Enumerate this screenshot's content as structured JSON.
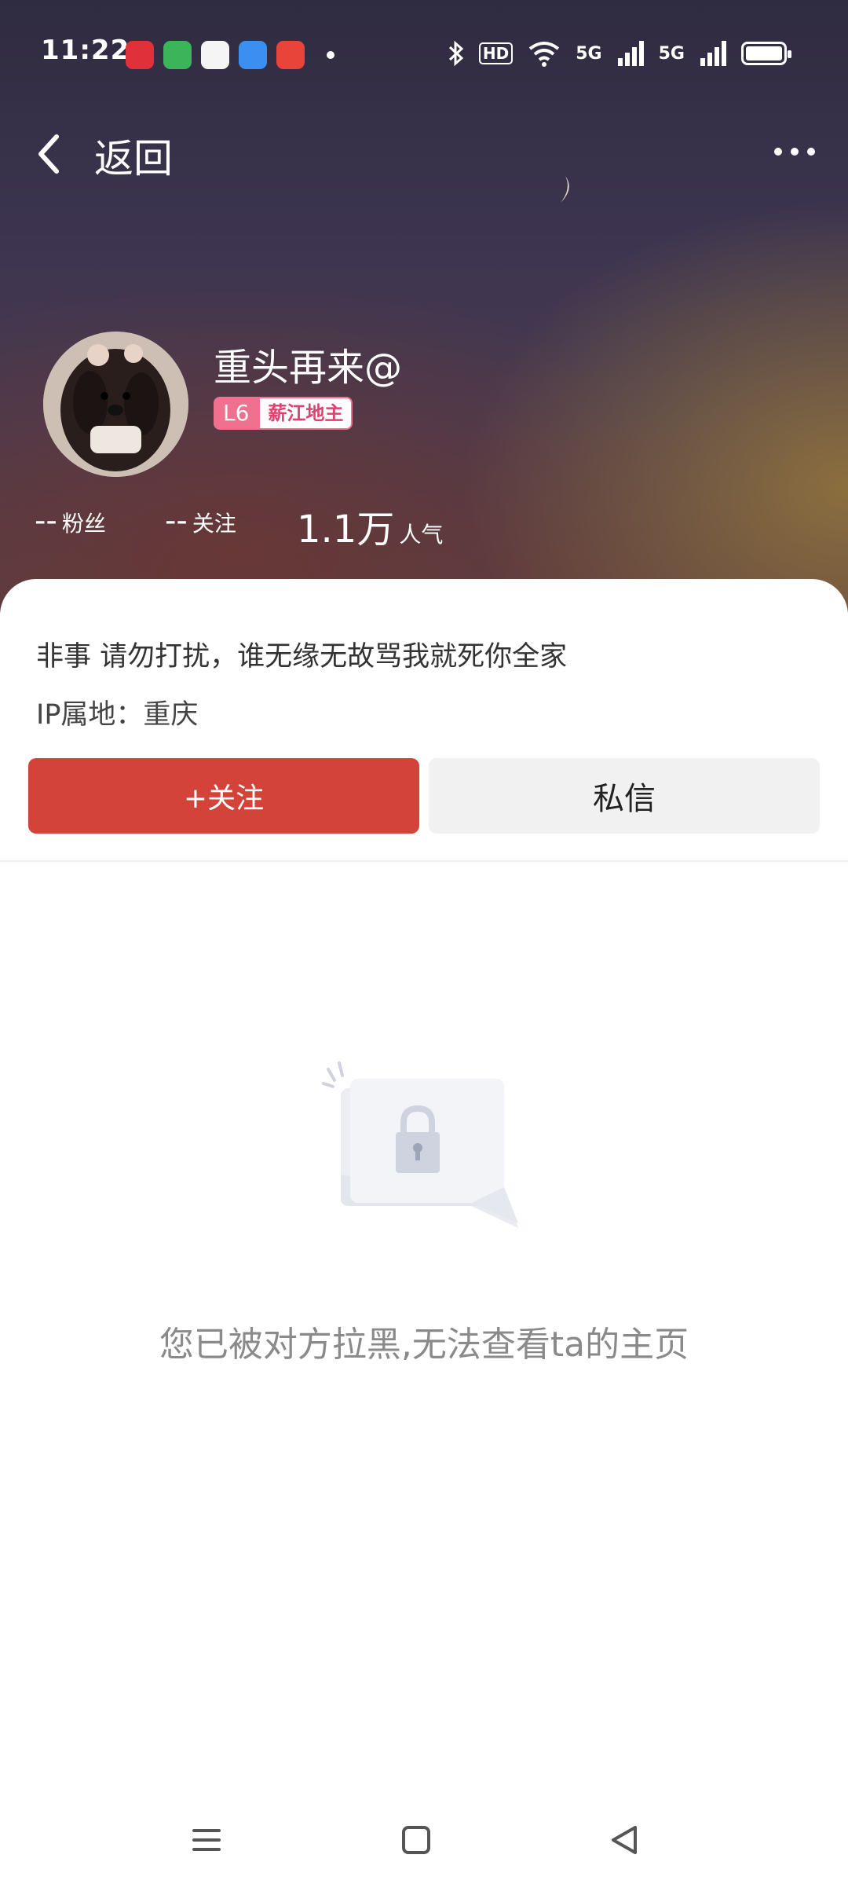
{
  "status_bar": {
    "time": "11:22",
    "network_1": "5G",
    "network_2": "5G",
    "hd_label": "HD"
  },
  "nav": {
    "back_label": "返回"
  },
  "profile": {
    "username": "重头再来@",
    "level_badge": "L6",
    "title_badge": "薪江地主",
    "fans_value": "--",
    "fans_label": "粉丝",
    "following_value": "--",
    "following_label": "关注",
    "popularity_value": "1.1万",
    "popularity_label": "人气"
  },
  "info": {
    "bio": "非事  请勿打扰，谁无缘无故骂我就死你全家",
    "ip_location": "IP属地：重庆"
  },
  "actions": {
    "follow_label": "+关注",
    "message_label": "私信"
  },
  "empty_state": {
    "message": "您已被对方拉黑,无法查看ta的主页"
  },
  "colors": {
    "follow_button": "#d4433a",
    "message_button": "#f1f1f1",
    "level_badge": "#f07090"
  }
}
